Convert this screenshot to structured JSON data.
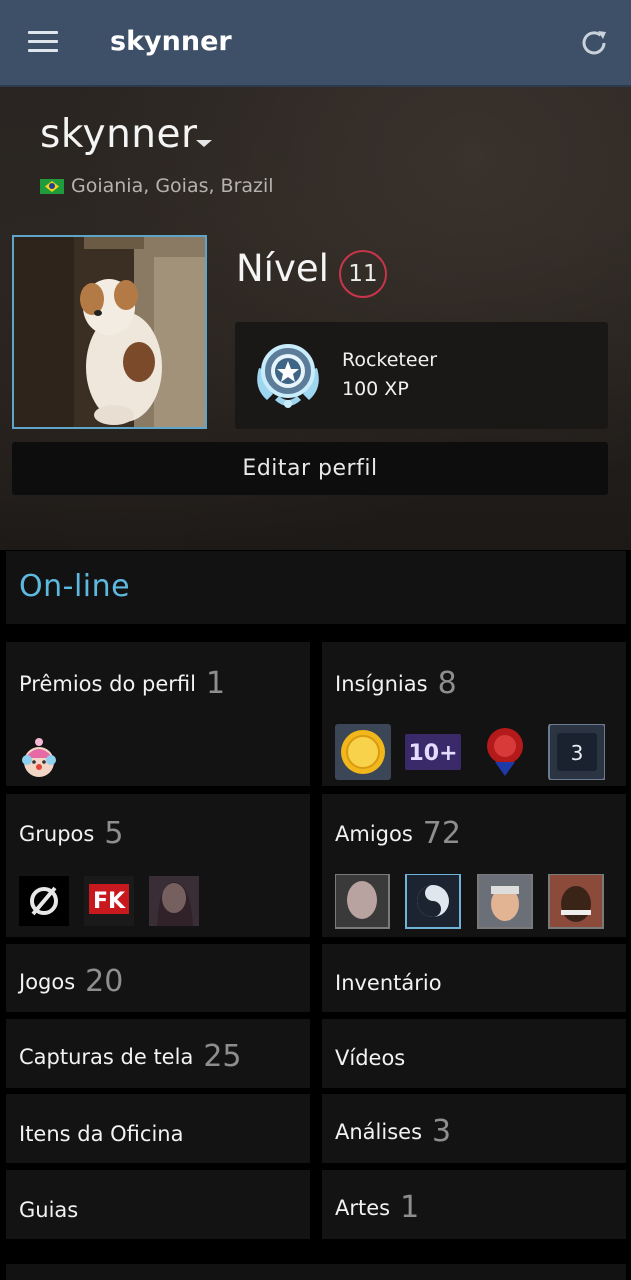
{
  "header": {
    "title": "skynner",
    "menu_icon": "hamburger-menu-icon",
    "refresh_icon": "refresh-icon"
  },
  "profile": {
    "username": "skynner",
    "location": "Goiania, Goias, Brazil",
    "level_label": "Nível",
    "level": "11",
    "featured_badge": {
      "name": "Rocketeer",
      "xp": "100 XP"
    },
    "edit_button": "Editar perfil",
    "status": "On-line"
  },
  "tiles": [
    {
      "label": "Prêmios do perfil",
      "count": "1"
    },
    {
      "label": "Insígnias",
      "count": "8"
    },
    {
      "label": "Grupos",
      "count": "5"
    },
    {
      "label": "Amigos",
      "count": "72"
    },
    {
      "label": "Jogos",
      "count": "20"
    },
    {
      "label": "Inventário",
      "count": ""
    },
    {
      "label": "Capturas de tela",
      "count": "25"
    },
    {
      "label": "Vídeos",
      "count": ""
    },
    {
      "label": "Itens da Oficina",
      "count": ""
    },
    {
      "label": "Análises",
      "count": "3"
    },
    {
      "label": "Guias",
      "count": ""
    },
    {
      "label": "Artes",
      "count": "1"
    }
  ],
  "badges_preview": {
    "badge_4_text": "3",
    "badge_2_text": "10+"
  },
  "colors": {
    "header_bg": "#3d5068",
    "status_online": "#5eb9e0",
    "level_ring": "#c8354a",
    "avatar_border": "#5fa4c9"
  }
}
